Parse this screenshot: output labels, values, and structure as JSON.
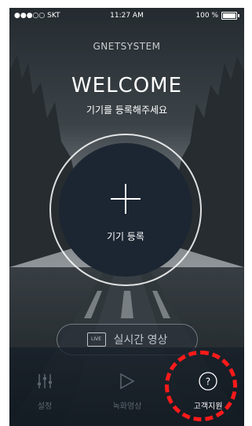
{
  "status_bar": {
    "carrier": "●●●○○ SKT",
    "time": "11:27 AM",
    "battery": "100 %"
  },
  "brand": "GNETSYSTEM",
  "welcome": {
    "title": "WELCOME",
    "subtitle": "기기를 등록해주세요"
  },
  "register_button": {
    "label": "기기 등록"
  },
  "live_button": {
    "icon_text": "LIVE",
    "label": "실시간 영상"
  },
  "tabs": [
    {
      "label": "설정",
      "icon": "settings-sliders-icon"
    },
    {
      "label": "녹화영상",
      "icon": "play-icon"
    },
    {
      "label": "고객지원",
      "icon": "help-circle-icon"
    }
  ],
  "colors": {
    "accent_highlight": "#ff1a1a",
    "circle_fill": "#1c2632"
  }
}
